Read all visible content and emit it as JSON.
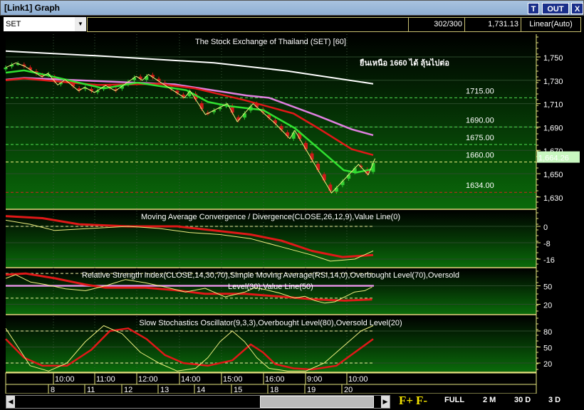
{
  "window": {
    "title": "[Link1] Graph",
    "btn_t": "T",
    "btn_out": "OUT",
    "btn_x": "X"
  },
  "toolbar": {
    "symbol": "SET",
    "count": "302/300",
    "price": "1,731.13",
    "scale": "Linear(Auto)"
  },
  "main": {
    "title": "The Stock Exchange of Thailand (SET) [60]",
    "annotation": "ยืนเหนือ 1660 ได้ ลุ้นไปต่อ",
    "levels": [
      {
        "label": "1715.00",
        "value": 1715
      },
      {
        "label": "1690.00",
        "value": 1690
      },
      {
        "label": "1675.00",
        "value": 1675
      },
      {
        "label": "1660.00",
        "value": 1660
      },
      {
        "label": "1634.00",
        "value": 1634
      }
    ],
    "axis": [
      "1,750",
      "1,730",
      "1,710",
      "1,690",
      "1,670",
      "1,650",
      "1,630"
    ],
    "axis_values": [
      1750,
      1730,
      1710,
      1690,
      1670,
      1650,
      1630
    ],
    "last_price": "1,664.26",
    "last_value": 1664.26
  },
  "macd": {
    "title": "Moving Average Convergence / Divergence(CLOSE,26,12,9),Value Line(0)",
    "axis": [
      "0",
      "-8",
      "-16"
    ],
    "axis_values": [
      0,
      -8,
      -16
    ]
  },
  "rsi": {
    "title": "Relative Strength Index(CLOSE,14,30,70),Simple Moving Average(RSI,14,0),Overbought Level(70),Oversold Level(30),Value Line(50)",
    "axis": [
      "50",
      "20"
    ],
    "axis_values": [
      50,
      20
    ]
  },
  "stoch": {
    "title": "Slow Stochastics Oscillator(9,3,3),Overbought Level(80),Oversold Level(20)",
    "axis": [
      "80",
      "50",
      "20"
    ],
    "axis_values": [
      80,
      50,
      20
    ]
  },
  "time_labels": [
    "10:00",
    "11:00",
    "12:00",
    "14:00",
    "15:00",
    "16:00",
    "9:00",
    "10:00"
  ],
  "day_labels": [
    "8",
    "11",
    "12",
    "13",
    "14",
    "15",
    "18",
    "19",
    "20"
  ],
  "bottom": {
    "f_plus": "F+",
    "f_minus": "F-",
    "zoom": [
      "FULL",
      "2 M",
      "30 D",
      "3 D"
    ]
  },
  "colors": {
    "price": "#f0f080",
    "ma_fast": "#30e030",
    "ma_mid": "#e01818",
    "ma_slow": "#e080e0",
    "ma_long": "#ffffff",
    "up": "#30d030",
    "down": "#d01818"
  },
  "chart_data": {
    "close_path": [
      [
        0,
        1740.9
      ],
      [
        1.7,
        1745
      ],
      [
        3.1,
        1742
      ],
      [
        5.9,
        1733
      ],
      [
        6.9,
        1736
      ],
      [
        8.5,
        1726
      ],
      [
        9.7,
        1730.5
      ],
      [
        11.9,
        1721
      ],
      [
        12.9,
        1724
      ],
      [
        14.5,
        1719.5
      ],
      [
        16.3,
        1725.6
      ],
      [
        17.9,
        1721
      ],
      [
        21.3,
        1733.5
      ],
      [
        22.3,
        1730
      ],
      [
        23.3,
        1735
      ],
      [
        29.2,
        1715
      ],
      [
        30.1,
        1721
      ],
      [
        32.6,
        1700.6
      ],
      [
        36.2,
        1710
      ],
      [
        37.8,
        1694.5
      ],
      [
        40.4,
        1710
      ],
      [
        44,
        1693
      ],
      [
        46.4,
        1680
      ],
      [
        47.2,
        1687
      ],
      [
        53.2,
        1633.5
      ],
      [
        57.6,
        1658
      ],
      [
        59.2,
        1649
      ],
      [
        60.3,
        1663
      ]
    ],
    "ma_fast": [
      [
        0,
        1736.5
      ],
      [
        3,
        1738.5
      ],
      [
        7,
        1734
      ],
      [
        16,
        1723
      ],
      [
        21.5,
        1728
      ],
      [
        29.5,
        1721.5
      ],
      [
        33,
        1711.5
      ],
      [
        36.3,
        1708
      ],
      [
        42,
        1704.5
      ],
      [
        47.2,
        1689
      ],
      [
        51.2,
        1671
      ],
      [
        55.2,
        1653
      ],
      [
        57.2,
        1651
      ],
      [
        60,
        1654
      ]
    ],
    "ma_mid": [
      [
        0,
        1730
      ],
      [
        3,
        1731.5
      ],
      [
        15,
        1726
      ],
      [
        25,
        1727
      ],
      [
        31,
        1723
      ],
      [
        39,
        1713
      ],
      [
        47,
        1701.5
      ],
      [
        51,
        1689
      ],
      [
        56.5,
        1671
      ],
      [
        60,
        1666
      ]
    ],
    "ma_slow": [
      [
        0,
        1730.5
      ],
      [
        3,
        1732
      ],
      [
        27.6,
        1726.5
      ],
      [
        39.3,
        1717
      ],
      [
        43,
        1715
      ],
      [
        51,
        1699.5
      ],
      [
        56.5,
        1688
      ],
      [
        60,
        1683
      ]
    ],
    "ma_long": [
      [
        0,
        1755
      ],
      [
        15,
        1751
      ],
      [
        34,
        1745
      ],
      [
        46,
        1738
      ],
      [
        60,
        1727
      ]
    ],
    "macd_line": [
      [
        0,
        3
      ],
      [
        4,
        1
      ],
      [
        8,
        -2
      ],
      [
        14,
        -1
      ],
      [
        20,
        0
      ],
      [
        25,
        -1
      ],
      [
        30,
        -3
      ],
      [
        35,
        -4
      ],
      [
        40,
        -6
      ],
      [
        45,
        -10
      ],
      [
        50,
        -14
      ],
      [
        53,
        -17
      ],
      [
        57,
        -16
      ],
      [
        60,
        -12
      ]
    ],
    "macd_signal": [
      [
        0,
        5
      ],
      [
        6,
        4
      ],
      [
        12,
        1
      ],
      [
        20,
        0
      ],
      [
        28,
        0
      ],
      [
        34,
        -2
      ],
      [
        40,
        -4
      ],
      [
        45,
        -7
      ],
      [
        50,
        -12
      ],
      [
        55,
        -15
      ],
      [
        60,
        -14
      ]
    ],
    "rsi_line": [
      [
        0,
        62
      ],
      [
        2,
        68
      ],
      [
        5,
        56
      ],
      [
        8,
        52
      ],
      [
        12,
        45
      ],
      [
        16,
        42
      ],
      [
        20,
        50
      ],
      [
        24,
        60
      ],
      [
        28,
        55
      ],
      [
        32,
        48
      ],
      [
        36,
        40
      ],
      [
        40,
        46
      ],
      [
        44,
        32
      ],
      [
        48,
        40
      ],
      [
        50,
        47
      ],
      [
        52,
        44
      ],
      [
        55,
        38
      ],
      [
        58,
        30
      ],
      [
        60,
        33
      ],
      [
        62,
        26
      ],
      [
        64,
        22
      ],
      [
        66,
        24
      ],
      [
        68,
        32
      ],
      [
        70,
        40
      ],
      [
        72,
        42
      ],
      [
        73.5,
        48
      ]
    ],
    "rsi_sma": [
      [
        0,
        68
      ],
      [
        4,
        70
      ],
      [
        10,
        62
      ],
      [
        16,
        52
      ],
      [
        20,
        47
      ],
      [
        28,
        47
      ],
      [
        34,
        43
      ],
      [
        40,
        37
      ],
      [
        48,
        37
      ],
      [
        56,
        32
      ],
      [
        62,
        28
      ],
      [
        68,
        26
      ],
      [
        73.5,
        28
      ]
    ],
    "stoch_k": [
      [
        0,
        85
      ],
      [
        2,
        50
      ],
      [
        4,
        15
      ],
      [
        7,
        5
      ],
      [
        10,
        20
      ],
      [
        13,
        60
      ],
      [
        16,
        90
      ],
      [
        19,
        75
      ],
      [
        22,
        40
      ],
      [
        25,
        20
      ],
      [
        28,
        5
      ],
      [
        31,
        10
      ],
      [
        33,
        30
      ],
      [
        35,
        60
      ],
      [
        37,
        80
      ],
      [
        39,
        60
      ],
      [
        41,
        30
      ],
      [
        43,
        10
      ],
      [
        46,
        5
      ],
      [
        49,
        5
      ],
      [
        52,
        20
      ],
      [
        55,
        50
      ],
      [
        58,
        80
      ],
      [
        60,
        90
      ]
    ],
    "stoch_d": [
      [
        0,
        65
      ],
      [
        3,
        30
      ],
      [
        6,
        15
      ],
      [
        10,
        15
      ],
      [
        14,
        45
      ],
      [
        17,
        80
      ],
      [
        20,
        85
      ],
      [
        23,
        65
      ],
      [
        26,
        35
      ],
      [
        29,
        20
      ],
      [
        33,
        15
      ],
      [
        37,
        25
      ],
      [
        40,
        55
      ],
      [
        42,
        40
      ],
      [
        44,
        18
      ],
      [
        47,
        10
      ],
      [
        50,
        8
      ],
      [
        54,
        15
      ],
      [
        57,
        40
      ],
      [
        60,
        65
      ]
    ]
  }
}
